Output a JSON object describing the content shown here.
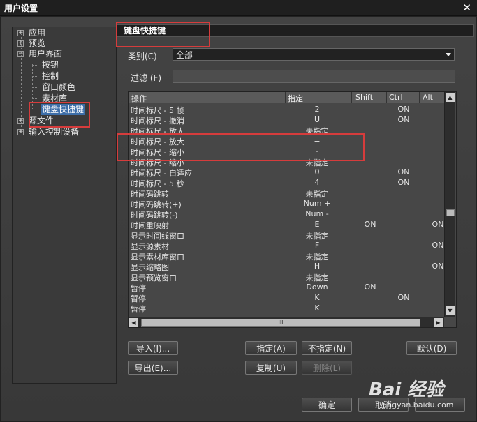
{
  "window": {
    "title": "用户设置",
    "close_glyph": "✕"
  },
  "tree": {
    "items": [
      {
        "label": "应用",
        "expander": "+"
      },
      {
        "label": "预览",
        "expander": "+"
      },
      {
        "label": "用户界面",
        "expander": "−"
      },
      {
        "label": "按钮"
      },
      {
        "label": "控制"
      },
      {
        "label": "窗口颜色"
      },
      {
        "label": "素材库"
      },
      {
        "label": "键盘快捷键",
        "selected": true
      },
      {
        "label": "源文件",
        "expander": "+"
      },
      {
        "label": "输入控制设备",
        "expander": "+"
      }
    ]
  },
  "section_title": "键盘快捷键",
  "category": {
    "label": "类别(C)",
    "value": "全部"
  },
  "filter": {
    "label": "过滤 (F)",
    "value": ""
  },
  "grid": {
    "headers": {
      "action": "操作",
      "key": "指定",
      "shift": "Shift",
      "ctrl": "Ctrl",
      "alt": "Alt"
    },
    "rows": [
      {
        "action": "时间标尺 - 5 帧",
        "key": "2",
        "shift": "",
        "ctrl": "ON",
        "alt": ""
      },
      {
        "action": "时间标尺 - 撤消",
        "key": "U",
        "shift": "",
        "ctrl": "ON",
        "alt": ""
      },
      {
        "action": "时间标尺 - 放大",
        "key": "未指定",
        "shift": "",
        "ctrl": "",
        "alt": ""
      },
      {
        "action": "时间标尺 - 放大",
        "key": "=",
        "shift": "",
        "ctrl": "",
        "alt": ""
      },
      {
        "action": "时间标尺 - 缩小",
        "key": "-",
        "shift": "",
        "ctrl": "",
        "alt": ""
      },
      {
        "action": "时间标尺 - 缩小",
        "key": "未指定",
        "shift": "",
        "ctrl": "",
        "alt": ""
      },
      {
        "action": "时间标尺 - 自适应",
        "key": "0",
        "shift": "",
        "ctrl": "ON",
        "alt": ""
      },
      {
        "action": "时间标尺 - 5 秒",
        "key": "4",
        "shift": "",
        "ctrl": "ON",
        "alt": ""
      },
      {
        "action": "时间码跳转",
        "key": "未指定",
        "shift": "",
        "ctrl": "",
        "alt": ""
      },
      {
        "action": "时间码跳转(+)",
        "key": "Num +",
        "shift": "",
        "ctrl": "",
        "alt": ""
      },
      {
        "action": "时间码跳转(-)",
        "key": "Num -",
        "shift": "",
        "ctrl": "",
        "alt": ""
      },
      {
        "action": "时间重映射",
        "key": "E",
        "shift": "ON",
        "ctrl": "",
        "alt": "ON"
      },
      {
        "action": "显示时间线窗口",
        "key": "未指定",
        "shift": "",
        "ctrl": "",
        "alt": ""
      },
      {
        "action": "显示源素材",
        "key": "F",
        "shift": "",
        "ctrl": "",
        "alt": "ON"
      },
      {
        "action": "显示素材库窗口",
        "key": "未指定",
        "shift": "",
        "ctrl": "",
        "alt": ""
      },
      {
        "action": "显示缩略图",
        "key": "H",
        "shift": "",
        "ctrl": "",
        "alt": "ON"
      },
      {
        "action": "显示预览窗口",
        "key": "未指定",
        "shift": "",
        "ctrl": "",
        "alt": ""
      },
      {
        "action": "暂停",
        "key": "Down",
        "shift": "ON",
        "ctrl": "",
        "alt": ""
      },
      {
        "action": "暂停",
        "key": "K",
        "shift": "",
        "ctrl": "ON",
        "alt": ""
      },
      {
        "action": "暂停",
        "key": "K",
        "shift": "",
        "ctrl": "",
        "alt": ""
      }
    ],
    "hscroll_grip": "III"
  },
  "buttons": {
    "import": "导入(I)...",
    "export": "导出(E)...",
    "assign": "指定(A)",
    "unassign": "不指定(N)",
    "copy": "复制(U)",
    "delete": "删除(L)",
    "default": "默认(D)",
    "ok": "确定",
    "cancel": "取消"
  },
  "watermark": {
    "brand": "Bai 经验",
    "url": "jingyan.baidu.com"
  },
  "colors": {
    "highlight": "#d63c3c",
    "selection": "#3d6ea8"
  }
}
